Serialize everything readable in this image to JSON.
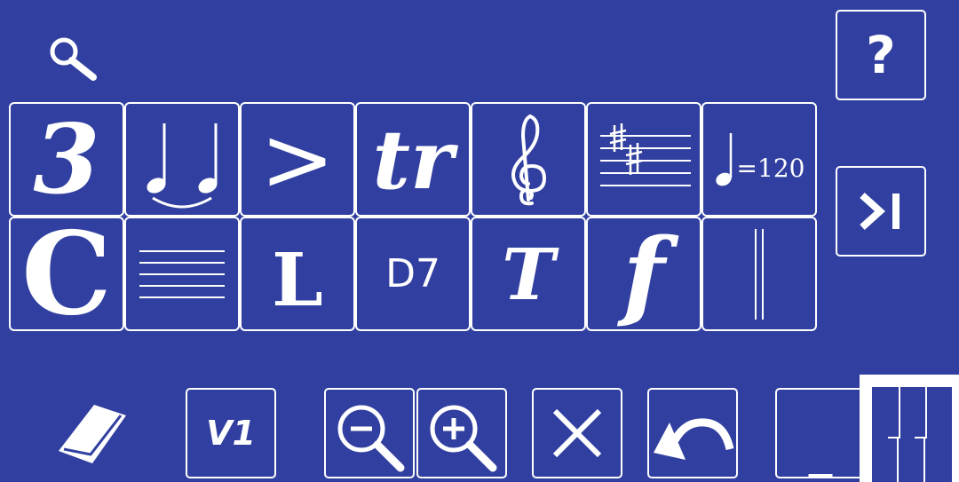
{
  "colors": {
    "background": "#3140a0",
    "foreground": "#ffffff",
    "piano_bg": "#ffffff",
    "piano_keys": "#3140a0"
  },
  "toolbar_top": {
    "search_icon": "magnifier-icon",
    "help_label": "?",
    "next_icon": "skip-to-end-icon"
  },
  "palette": {
    "row1": [
      {
        "id": "tuplet",
        "label": "3"
      },
      {
        "id": "slur",
        "icon": "slur-notes-icon"
      },
      {
        "id": "accent",
        "label": ">"
      },
      {
        "id": "trill",
        "label": "tr"
      },
      {
        "id": "clef",
        "icon": "treble-clef-icon"
      },
      {
        "id": "key-signature",
        "icon": "key-signature-icon"
      },
      {
        "id": "tempo",
        "label": "=120"
      }
    ],
    "row2": [
      {
        "id": "time-signature",
        "label": "C"
      },
      {
        "id": "staff",
        "icon": "staff-lines-icon"
      },
      {
        "id": "lyrics",
        "label": "L"
      },
      {
        "id": "chord",
        "label": "D7"
      },
      {
        "id": "text",
        "label": "T"
      },
      {
        "id": "dynamics",
        "label": "f"
      },
      {
        "id": "barline",
        "icon": "double-barline-icon"
      }
    ]
  },
  "bottom": {
    "eraser_icon": "eraser-icon",
    "voice_label": "V1",
    "zoom_out_icon": "zoom-out-icon",
    "zoom_in_icon": "zoom-in-icon",
    "close_icon": "close-icon",
    "undo_icon": "undo-icon",
    "minimize_label": "_",
    "piano_icon": "piano-keyboard-icon"
  }
}
